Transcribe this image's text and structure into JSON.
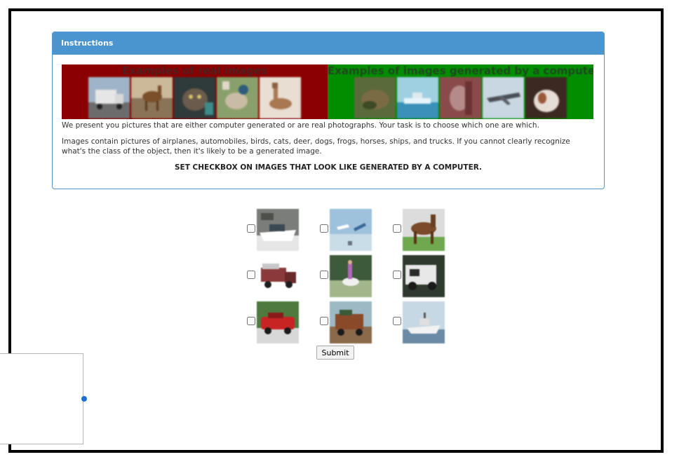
{
  "panel": {
    "heading": "Instructions",
    "banner": {
      "real_title": "Examples of real images",
      "generated_title": "Examples of images generated by a computer",
      "real_color": "#8b0000",
      "generated_color": "#008d00",
      "real_images": [
        "truck-photo",
        "deer-photo",
        "cat-photo",
        "dog-photo",
        "deer-photo"
      ],
      "generated_images": [
        "frog-generated",
        "ship-generated",
        "bird-generated",
        "airplane-generated",
        "dog-generated"
      ]
    },
    "text1": "We present you pictures that are either computer generated or are real photographs. Your task is to choose which one are which.",
    "text2": "Images contain pictures of airplanes, automobiles, birds, cats, deer, dogs, frogs, horses, ships, and trucks. If you cannot clearly recognize what's the class of the object, then it's likely to be a generated image.",
    "text3": "SET CHECKBOX ON IMAGES THAT LOOK LIKE GENERATED BY A COMPUTER."
  },
  "grid": {
    "images": [
      {
        "subject": "boat-image",
        "checked": false
      },
      {
        "subject": "airplane-image",
        "checked": false
      },
      {
        "subject": "horse-image",
        "checked": false
      },
      {
        "subject": "truck-image",
        "checked": false
      },
      {
        "subject": "horse-rider-image",
        "checked": false
      },
      {
        "subject": "truck-image",
        "checked": false
      },
      {
        "subject": "car-image",
        "checked": false
      },
      {
        "subject": "truck-image",
        "checked": false
      },
      {
        "subject": "ship-image",
        "checked": false
      }
    ]
  },
  "submit_label": "Submit",
  "colors": {
    "heading_bg": "#4a94d0",
    "border": "#000000"
  }
}
